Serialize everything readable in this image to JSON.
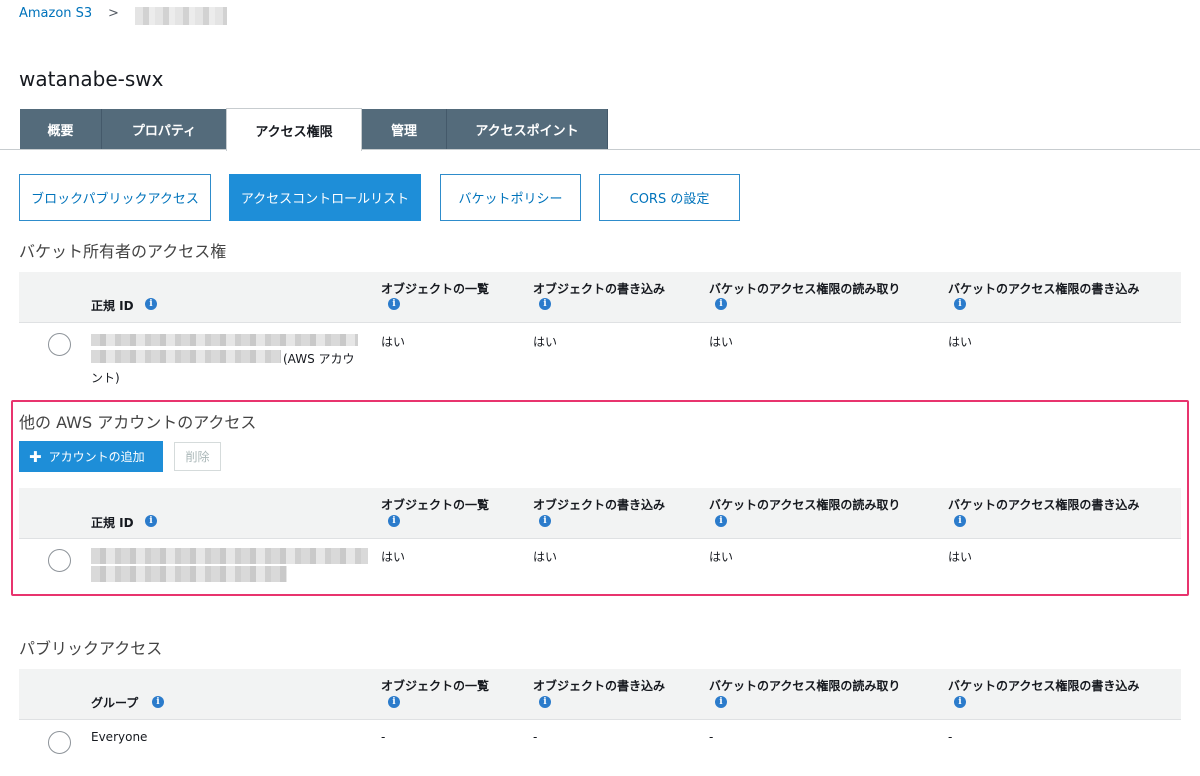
{
  "breadcrumb": {
    "root": "Amazon S3",
    "separator": ">"
  },
  "bucket_name": "watanabe-swx",
  "tabs": [
    "概要",
    "プロパティ",
    "アクセス権限",
    "管理",
    "アクセスポイント"
  ],
  "active_tab": "アクセス権限",
  "sub_buttons": [
    "ブロックパブリックアクセス",
    "アクセスコントロールリスト",
    "バケットポリシー",
    "CORS の設定"
  ],
  "active_sub_button": "アクセスコントロールリスト",
  "columns": {
    "list": "オブジェクトの一覧",
    "write": "オブジェクトの書き込み",
    "acl_read": "バケットのアクセス権限の読み取り",
    "acl_write": "バケットのアクセス権限の書き込み"
  },
  "info_glyph": "i",
  "owner_section": {
    "title": "バケット所有者のアクセス権",
    "id_header": "正規 ID",
    "row": {
      "account_suffix_1": "(AWS アカウ",
      "account_suffix_2": "ント)",
      "list": "はい",
      "write": "はい",
      "acl_read": "はい",
      "acl_write": "はい"
    }
  },
  "other_accounts_section": {
    "title": "他の AWS アカウントのアクセス",
    "add_button": "アカウントの追加",
    "add_icon": "plus-icon",
    "delete_button": "削除",
    "id_header": "正規 ID",
    "row": {
      "list": "はい",
      "write": "はい",
      "acl_read": "はい",
      "acl_write": "はい"
    }
  },
  "public_section": {
    "title": "パブリックアクセス",
    "group_header": "グループ",
    "row": {
      "group": "Everyone",
      "list": "-",
      "write": "-",
      "acl_read": "-",
      "acl_write": "-"
    }
  },
  "colors": {
    "accent": "#1e8ed8",
    "tab_bg": "#546b7b",
    "highlight": "#e8346e",
    "link": "#0073bb"
  }
}
